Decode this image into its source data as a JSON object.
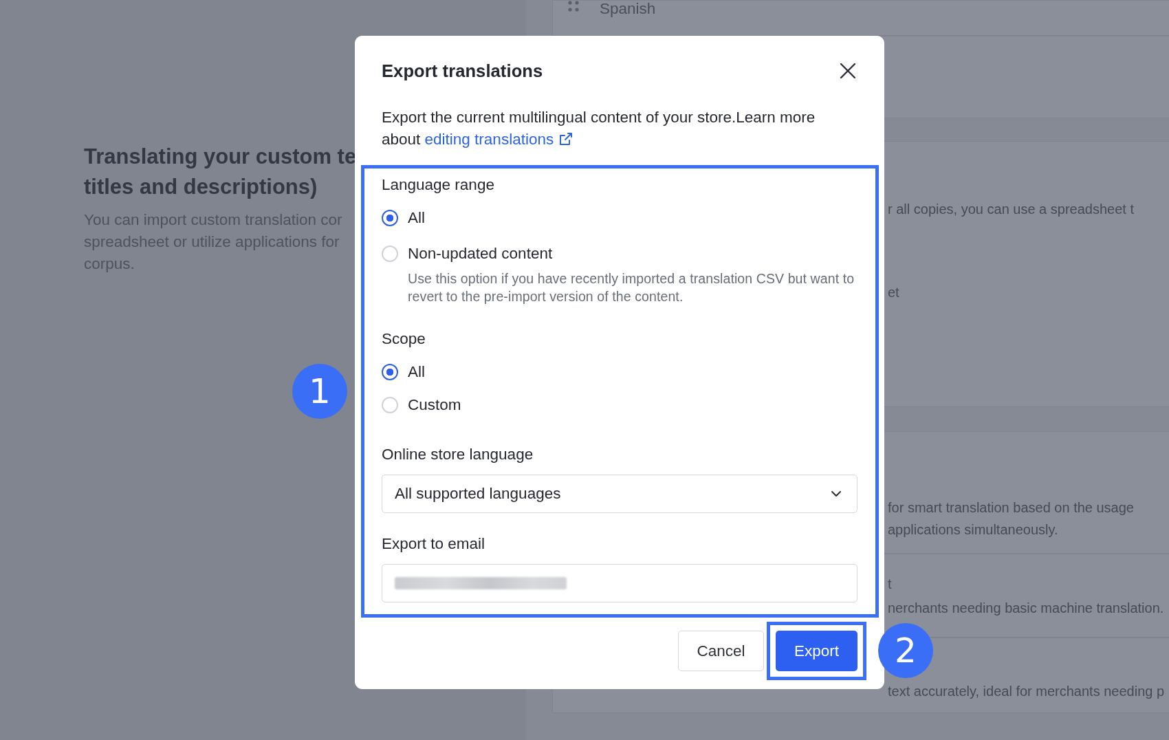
{
  "background": {
    "language": "Spanish",
    "section": {
      "title_lines": [
        "Translating your custom te",
        "titles and descriptions)"
      ],
      "text_lines": [
        "You can import custom translation cor",
        "spreadsheet or utilize applications for",
        "corpus."
      ]
    },
    "fragments": [
      {
        "lines": [
          "r all copies, you can use a spreadsheet t",
          "et"
        ]
      },
      {
        "lines": [
          "for smart translation based on the usage",
          "applications simultaneously."
        ]
      },
      {
        "lines": [
          "t",
          "nerchants needing basic machine translation."
        ]
      },
      {
        "lines": [
          "text accurately, ideal for merchants needing p"
        ]
      }
    ]
  },
  "dialog": {
    "title": "Export translations",
    "intro": "Export the current multilingual content of your store.Learn more about",
    "link": "editing translations",
    "sections": [
      {
        "kind": "radio",
        "label": "Language range",
        "options": [
          {
            "label": "All",
            "selected": true
          },
          {
            "label": "Non-updated content",
            "selected": false,
            "help": "Use this option if you have recently imported a translation CSV but want to revert to the pre-import version of the content."
          }
        ]
      },
      {
        "kind": "radio",
        "label": "Scope",
        "options": [
          {
            "label": "All",
            "selected": true
          },
          {
            "label": "Custom",
            "selected": false
          }
        ]
      },
      {
        "kind": "select",
        "label": "Online store language",
        "value": "All supported languages"
      },
      {
        "kind": "email",
        "label": "Export to email",
        "redacted": true
      }
    ],
    "buttons": [
      {
        "label": "Cancel",
        "primary": false
      },
      {
        "label": "Export",
        "primary": true
      }
    ]
  },
  "callouts": [
    {
      "number": "1"
    },
    {
      "number": "2"
    }
  ]
}
